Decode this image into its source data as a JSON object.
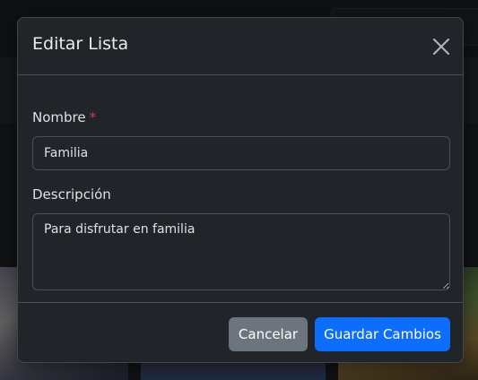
{
  "modal": {
    "title": "Editar Lista",
    "close_icon": "close-icon"
  },
  "form": {
    "name_label": "Nombre",
    "required_marker": "*",
    "name_value": "Familia",
    "description_label": "Descripción",
    "description_value": "Para disfrutar en familia"
  },
  "footer": {
    "cancel_label": "Cancelar",
    "save_label": "Guardar Cambios"
  },
  "colors": {
    "primary": "#0d6efd",
    "secondary": "#6c757d",
    "required": "#dc3545",
    "surface": "#212529"
  }
}
